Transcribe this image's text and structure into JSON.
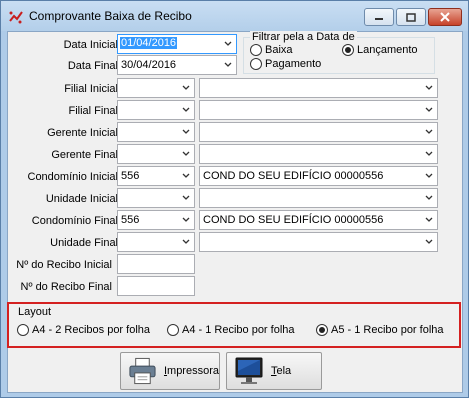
{
  "window": {
    "title": "Comprovante Baixa de Recibo",
    "icon": "app-logo-icon",
    "controls": [
      "minimize-icon",
      "maximize-icon",
      "close-icon"
    ]
  },
  "fields": {
    "data_inicial": {
      "label": "Data Inicial",
      "value": "01/04/2016"
    },
    "data_final": {
      "label": "Data Final",
      "value": "30/04/2016"
    },
    "filial_inicial": {
      "label": "Filial Inicial",
      "value": "",
      "desc": ""
    },
    "filial_final": {
      "label": "Filial Final",
      "value": "",
      "desc": ""
    },
    "gerente_inicial": {
      "label": "Gerente Inicial",
      "value": "",
      "desc": ""
    },
    "gerente_final": {
      "label": "Gerente Final",
      "value": "",
      "desc": ""
    },
    "condominio_inicial": {
      "label": "Condomínio Inicial",
      "value": "556",
      "desc": "COND DO SEU EDIFÍCIO 00000556"
    },
    "unidade_inicial": {
      "label": "Unidade Inicial",
      "value": "",
      "desc": ""
    },
    "condominio_final": {
      "label": "Condomínio Final",
      "value": "556",
      "desc": "COND DO SEU EDIFÍCIO 00000556"
    },
    "unidade_final": {
      "label": "Unidade Final",
      "value": "",
      "desc": ""
    },
    "recibo_inicial": {
      "label": "Nº do Recibo Inicial",
      "value": ""
    },
    "recibo_final": {
      "label": "Nº do Recibo Final",
      "value": ""
    }
  },
  "filtro": {
    "title": "Filtrar pela a Data de",
    "options": [
      {
        "label": "Baixa",
        "selected": false
      },
      {
        "label": "Lançamento",
        "selected": true
      },
      {
        "label": "Pagamento",
        "selected": false
      }
    ]
  },
  "layout": {
    "title": "Layout",
    "options": [
      {
        "label": "A4 - 2 Recibos por folha",
        "selected": false
      },
      {
        "label": "A4 - 1 Recibo por folha",
        "selected": false
      },
      {
        "label": "A5 - 1 Recibo por folha",
        "selected": true
      }
    ]
  },
  "buttons": {
    "impressora": {
      "label_first": "I",
      "label_rest": "mpressora",
      "icon": "printer-icon"
    },
    "tela": {
      "label_first": "T",
      "label_rest": "ela",
      "icon": "monitor-icon"
    }
  },
  "colors": {
    "highlight_border": "#d42020",
    "selection": "#3399ff"
  }
}
